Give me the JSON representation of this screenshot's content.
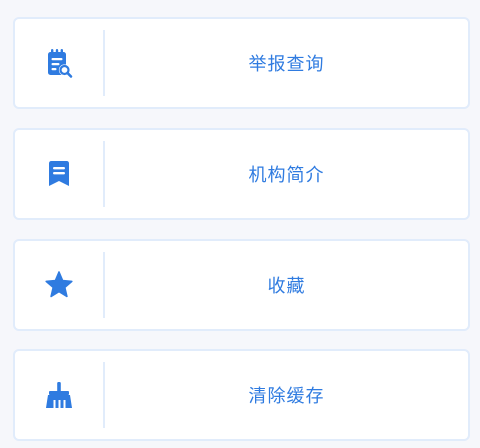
{
  "accent_color": "#2f7be0",
  "menu": {
    "items": [
      {
        "label": "举报查询",
        "icon": "report-search-icon"
      },
      {
        "label": "机构简介",
        "icon": "bookmark-doc-icon"
      },
      {
        "label": "收藏",
        "icon": "star-icon"
      },
      {
        "label": "清除缓存",
        "icon": "broom-icon"
      }
    ]
  }
}
